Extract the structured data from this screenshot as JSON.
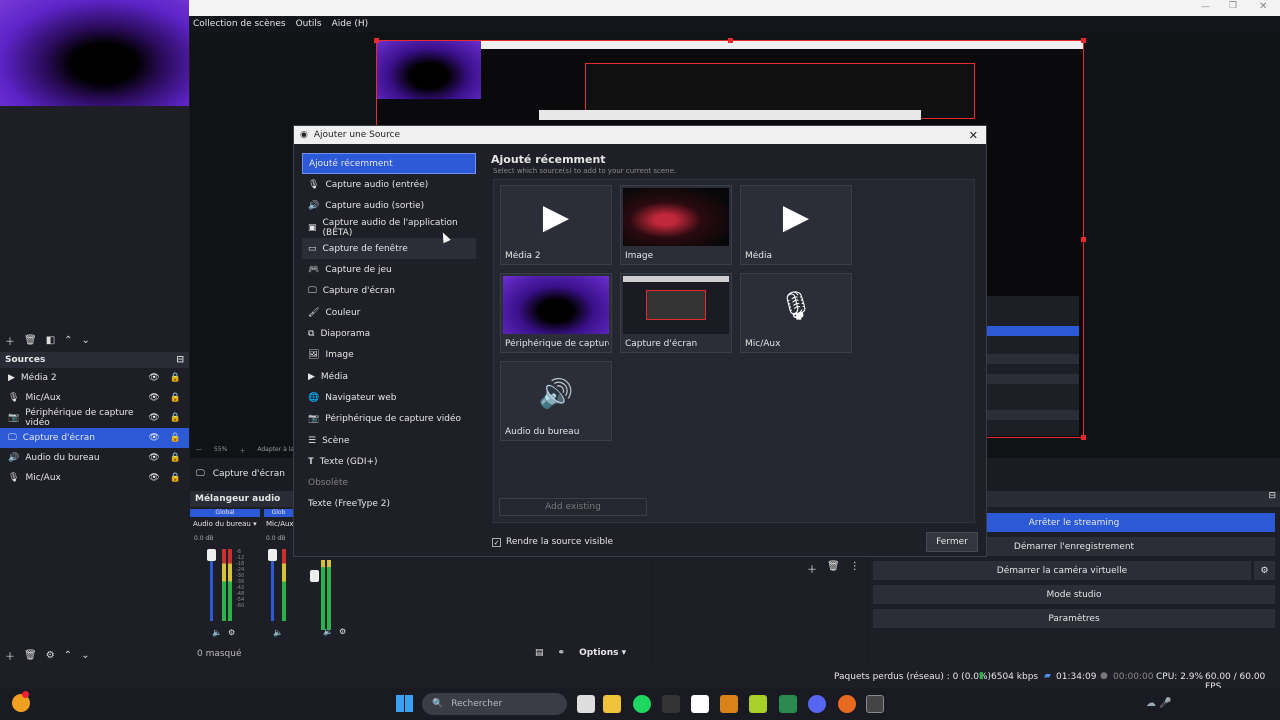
{
  "menubar": {
    "items": [
      "Collection de scènes",
      "Outils",
      "Aide (H)"
    ]
  },
  "sources_dock": {
    "title": "Sources",
    "items": [
      {
        "label": "Média 2",
        "icon": "play-icon"
      },
      {
        "label": "Mic/Aux",
        "icon": "mic-icon"
      },
      {
        "label": "Périphérique de capture vidéo",
        "icon": "camera-icon"
      },
      {
        "label": "Capture d'écran",
        "icon": "monitor-icon",
        "selected": true
      },
      {
        "label": "Audio du bureau",
        "icon": "speaker-icon"
      },
      {
        "label": "Mic/Aux",
        "icon": "mic-icon"
      }
    ]
  },
  "preview_zoom": {
    "value": "55%",
    "fit_label": "Adapter à la f"
  },
  "selected_source_bar": "Capture d'écran",
  "mixer": {
    "title": "Mélangeur audio",
    "global_labels": [
      "Global",
      "Glob"
    ],
    "channels": [
      {
        "name": "Audio du bureau",
        "db": "0.0 dB"
      },
      {
        "name": "Mic/Aux",
        "db": "0.0 dB"
      }
    ],
    "scale": [
      "-6",
      "-12",
      "-18",
      "-24",
      "-30",
      "-36",
      "-42",
      "-48",
      "-54",
      "-60"
    ],
    "hidden_count": "0 masqué",
    "options_label": "Options"
  },
  "dialog": {
    "title": "Ajouter une Source",
    "types": [
      {
        "label": "Ajouté récemment",
        "icon": "",
        "state": "selected"
      },
      {
        "label": "Capture audio (entrée)",
        "icon": "mic-icon"
      },
      {
        "label": "Capture audio (sortie)",
        "icon": "speaker-icon"
      },
      {
        "label": "Capture audio de l'application (BÊTA)",
        "icon": "app-audio-icon"
      },
      {
        "label": "Capture de fenêtre",
        "icon": "window-icon",
        "state": "hover"
      },
      {
        "label": "Capture de jeu",
        "icon": "gamepad-icon"
      },
      {
        "label": "Capture d'écran",
        "icon": "monitor-icon"
      },
      {
        "label": "Couleur",
        "icon": "brush-icon"
      },
      {
        "label": "Diaporama",
        "icon": "slideshow-icon"
      },
      {
        "label": "Image",
        "icon": "image-icon"
      },
      {
        "label": "Média",
        "icon": "play-icon"
      },
      {
        "label": "Navigateur web",
        "icon": "globe-icon"
      },
      {
        "label": "Périphérique de capture vidéo",
        "icon": "camera-icon"
      },
      {
        "label": "Scène",
        "icon": "list-icon"
      },
      {
        "label": "Texte (GDI+)",
        "icon": "text-icon"
      },
      {
        "label": "Obsolète",
        "icon": "",
        "state": "obsolete"
      },
      {
        "label": "Texte (FreeType 2)",
        "icon": ""
      }
    ],
    "recent_heading": "Ajouté récemment",
    "recent_sub": "Select which source(s) to add to your current scene.",
    "tiles": [
      {
        "label": "Média 2",
        "thumb": "play"
      },
      {
        "label": "Image",
        "thumb": "image"
      },
      {
        "label": "Média",
        "thumb": "play"
      },
      {
        "label": "Périphérique de capture vi",
        "thumb": "webcam"
      },
      {
        "label": "Capture d'écran",
        "thumb": "screen"
      },
      {
        "label": "Mic/Aux",
        "thumb": "mic"
      },
      {
        "label": "Audio du bureau",
        "thumb": "speaker"
      }
    ],
    "add_existing": "Add existing",
    "visible_label": "Rendre la source visible",
    "close_label": "Fermer"
  },
  "controls": {
    "stop_streaming": "Arrêter le streaming",
    "start_recording": "Démarrer l'enregistrement",
    "start_virtual_cam": "Démarrer la caméra virtuelle",
    "studio_mode": "Mode studio",
    "settings": "Paramètres"
  },
  "status": {
    "dropped": "Paquets perdus (réseau) : 0 (0.0%)",
    "bitrate": "6504 kbps",
    "stream_time": "01:34:09",
    "rec_time": "00:00:00",
    "cpu": "CPU: 2.9%",
    "fps": "60.00 / 60.00 FPS"
  },
  "taskbar": {
    "search_placeholder": "Rechercher"
  },
  "colors": {
    "accent": "#2c5ad7",
    "record_red": "#e82a2a"
  }
}
